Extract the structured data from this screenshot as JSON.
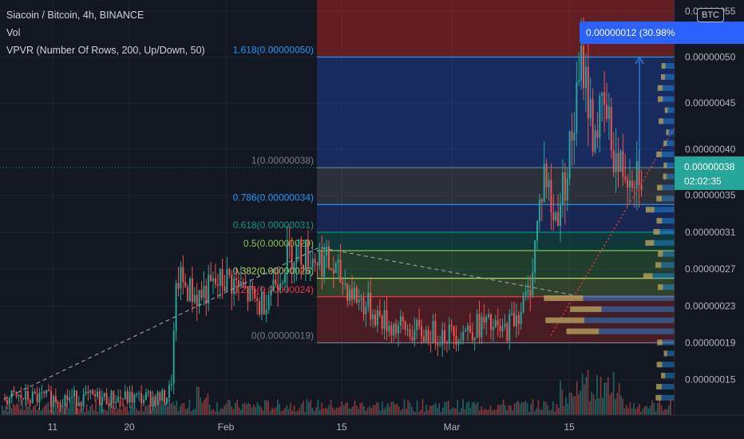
{
  "legend": {
    "title": "Siacoin / Bitcoin, 4h, BINANCE",
    "vol": "Vol",
    "vpvr": "VPVR (Number Of Rows, 200, Up/Down, 50)"
  },
  "price_badge": {
    "value": "0.00000038",
    "countdown": "02:02:35"
  },
  "currency_badge": "BTC",
  "measure_label": "0.00000012 (30.98%",
  "colors": {
    "background": "#131722",
    "up": "#26a69a",
    "down": "#ef5350",
    "fib_top": "#2962ff",
    "vpvr": "#2196f3",
    "vpvr_highlight": "#f7b32b"
  },
  "chart_data": {
    "type": "candlestick",
    "symbol": "SC/BTC",
    "interval": "4h",
    "exchange": "BINANCE",
    "ylim": [
      1.1e-08,
      5.5e-08
    ],
    "y_ticks": [
      "0.00000055",
      "0.00000050",
      "0.00000045",
      "0.00000040",
      "0.00000035",
      "0.00000031",
      "0.00000027",
      "0.00000023",
      "0.00000019",
      "0.00000015"
    ],
    "y_tick_values": [
      5.5e-08,
      5e-08,
      4.5e-08,
      4e-08,
      3.5e-08,
      3.1e-08,
      2.7e-08,
      2.3e-08,
      1.9e-08,
      1.5e-08
    ],
    "x_ticks": [
      "11",
      "20",
      "Feb",
      "15",
      "Mar",
      "15"
    ],
    "fib_levels": [
      {
        "ratio": "1.618",
        "label": "1.618(0.00000050)",
        "price": 5e-08,
        "color": "#2196f3"
      },
      {
        "ratio": "1",
        "label": "1(0.00000038)",
        "price": 3.8e-08,
        "color": "#787b86"
      },
      {
        "ratio": "0.786",
        "label": "0.786(0.00000034)",
        "price": 3.4e-08,
        "color": "#2196f3"
      },
      {
        "ratio": "0.618",
        "label": "0.618(0.00000031)",
        "price": 3.1e-08,
        "color": "#089981"
      },
      {
        "ratio": "0.5",
        "label": "0.5(0.00000029)",
        "price": 2.9e-08,
        "color": "#8bc34a"
      },
      {
        "ratio": "0.382",
        "label": "0.382(0.00000026)",
        "price": 2.6e-08,
        "color": "#b2d965"
      },
      {
        "ratio": "0.236",
        "label": "0.236(0.00000024)",
        "price": 2.4e-08,
        "color": "#f23645"
      },
      {
        "ratio": "0",
        "label": "0(0.00000019)",
        "price": 1.9e-08,
        "color": "#787b86"
      }
    ],
    "price_path": [
      [
        0,
        1.3e-08
      ],
      [
        0.25,
        1.3e-08
      ],
      [
        0.26,
        1.4e-08
      ],
      [
        0.27,
        2.6e-08
      ],
      [
        0.3,
        2.4e-08
      ],
      [
        0.35,
        2.6e-08
      ],
      [
        0.4,
        2.3e-08
      ],
      [
        0.45,
        2.9e-08
      ],
      [
        0.5,
        2.8e-08
      ],
      [
        0.55,
        2.4e-08
      ],
      [
        0.6,
        2.1e-08
      ],
      [
        0.65,
        2e-08
      ],
      [
        0.7,
        2e-08
      ],
      [
        0.75,
        2.1e-08
      ],
      [
        0.78,
        2e-08
      ],
      [
        0.8,
        2.2e-08
      ],
      [
        0.82,
        2.4e-08
      ],
      [
        0.845,
        3.8e-08
      ],
      [
        0.86,
        3.2e-08
      ],
      [
        0.875,
        3.6e-08
      ],
      [
        0.89,
        4.2e-08
      ],
      [
        0.905,
        5e-08
      ],
      [
        0.92,
        4.2e-08
      ],
      [
        0.94,
        4.4e-08
      ],
      [
        0.96,
        3.8e-08
      ]
    ],
    "current_price": 3.8e-08
  }
}
